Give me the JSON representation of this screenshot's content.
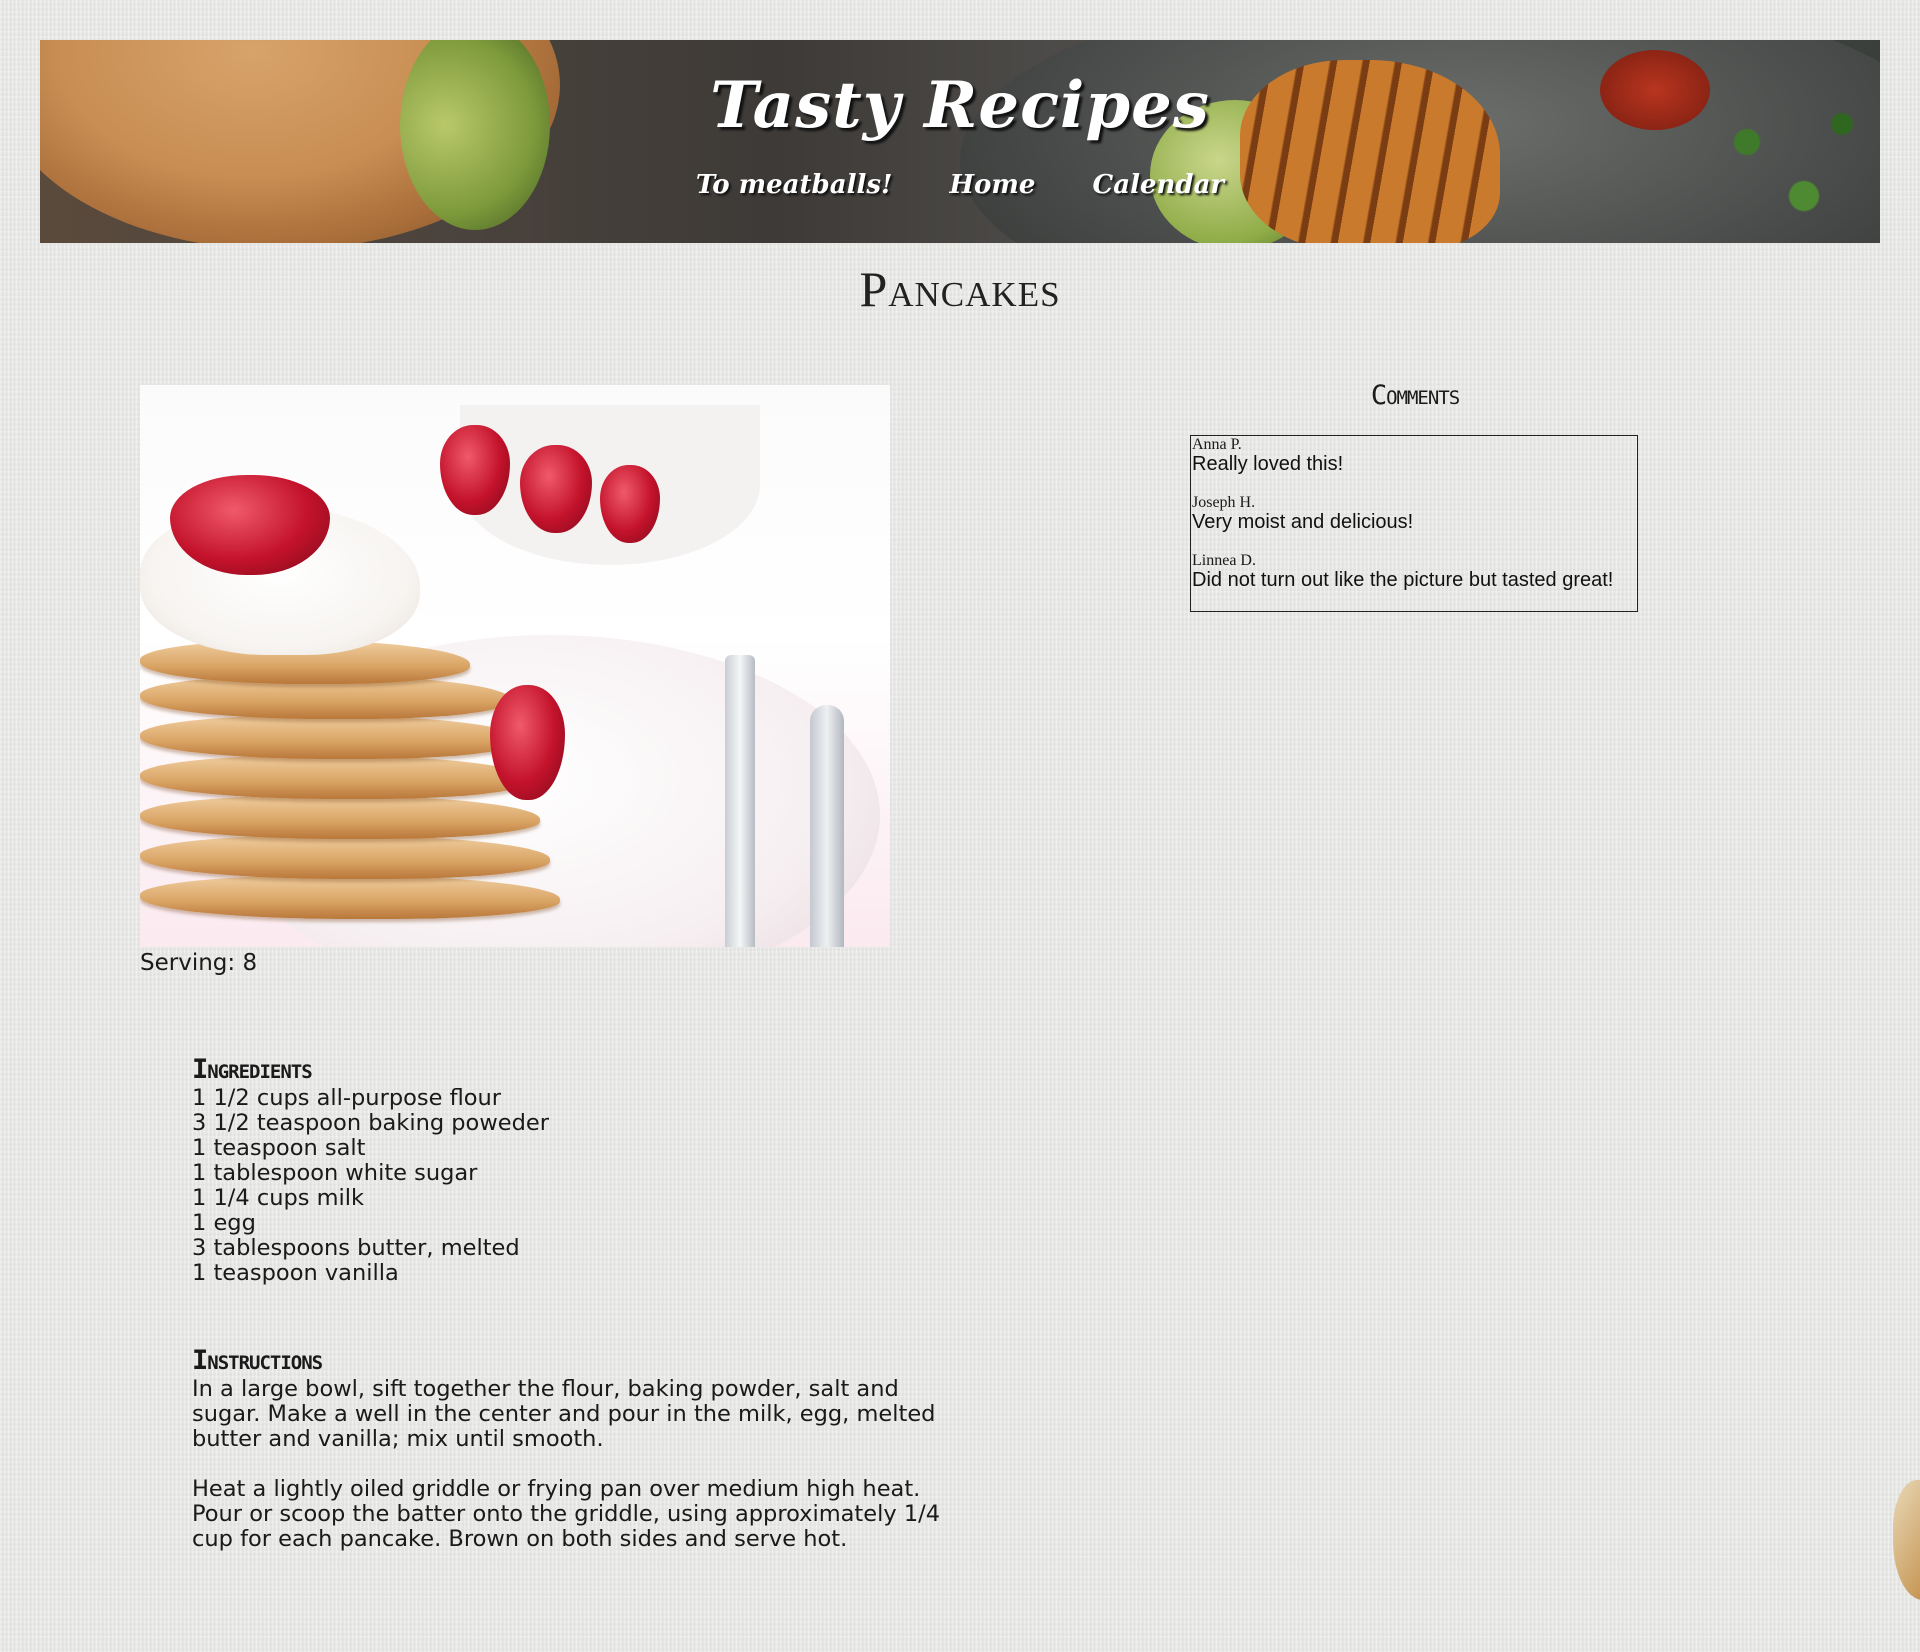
{
  "site": {
    "title": "Tasty Recipes"
  },
  "nav": {
    "items": [
      {
        "label": "To meatballs!"
      },
      {
        "label": "Home"
      },
      {
        "label": "Calendar"
      }
    ]
  },
  "recipe": {
    "title": "Pancakes",
    "serving": "Serving: 8",
    "ingredients_title": "Ingredients",
    "ingredients": [
      "1 1/2 cups all-purpose flour",
      "3 1/2 teaspoon baking poweder",
      "1 teaspoon salt",
      "1 tablespoon white sugar",
      "1 1/4 cups milk",
      "1 egg",
      "3 tablespoons butter, melted",
      "1 teaspoon vanilla"
    ],
    "instructions_title": "Instructions",
    "instructions": [
      "In a large bowl, sift together the flour, baking powder, salt and sugar. Make a well in the center and pour in the milk, egg, melted butter and vanilla; mix until smooth.",
      "Heat a lightly oiled griddle or frying pan over medium high heat. Pour or scoop the batter onto the griddle, using approximately 1/4 cup for each pancake. Brown on both sides and serve hot."
    ]
  },
  "comments": {
    "title": "Comments",
    "items": [
      {
        "author": "Anna P.",
        "text": "Really loved this!"
      },
      {
        "author": "Joseph H.",
        "text": "Very moist and delicious!"
      },
      {
        "author": "Linnea D.",
        "text": "Did not turn out like the picture but tasted great!"
      }
    ]
  }
}
